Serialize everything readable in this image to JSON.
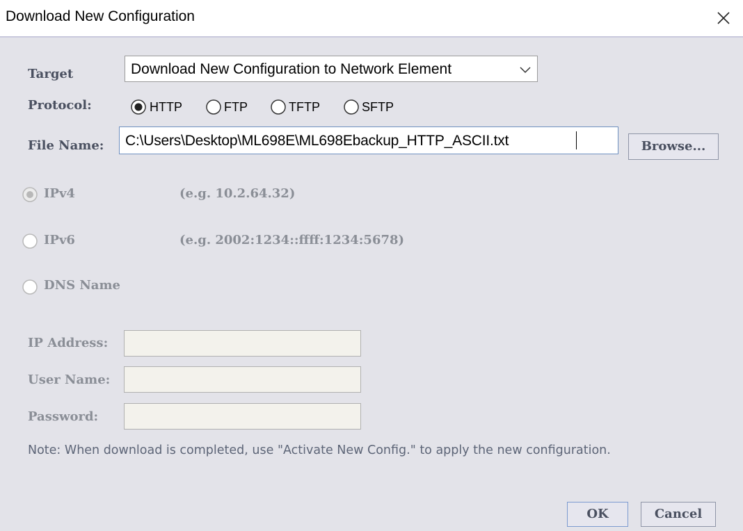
{
  "window": {
    "title": "Download New Configuration"
  },
  "labels": {
    "target": "Target",
    "protocol": "Protocol:",
    "file_name": "File Name:",
    "ip_address": "IP Address:",
    "user_name": "User Name:",
    "password": "Password:"
  },
  "target": {
    "selected": "Download New Configuration to Network Element"
  },
  "protocols": [
    {
      "label": "HTTP",
      "selected": true
    },
    {
      "label": "FTP",
      "selected": false
    },
    {
      "label": "TFTP",
      "selected": false
    },
    {
      "label": "SFTP",
      "selected": false
    }
  ],
  "file_name": {
    "value": "C:\\Users\\Desktop\\ML698E\\ML698Ebackup_HTTP_ASCII.txt"
  },
  "buttons": {
    "browse": "Browse...",
    "ok": "OK",
    "cancel": "Cancel"
  },
  "address_types": [
    {
      "label": "IPv4",
      "example": "(e.g. 10.2.64.32)",
      "selected": true
    },
    {
      "label": "IPv6",
      "example": "(e.g. 2002:1234::ffff:1234:5678)",
      "selected": false
    },
    {
      "label": "DNS Name",
      "example": "",
      "selected": false
    }
  ],
  "fields": {
    "ip_address": "",
    "user_name": "",
    "password": ""
  },
  "note": "Note: When download is completed, use \"Activate New Config.\" to apply the new configuration.",
  "colors": {
    "panel_bg": "#e3e3e9",
    "label_text": "#4a5060",
    "disabled_text": "#8a8e96",
    "field_bg": "#f3f2ec"
  }
}
